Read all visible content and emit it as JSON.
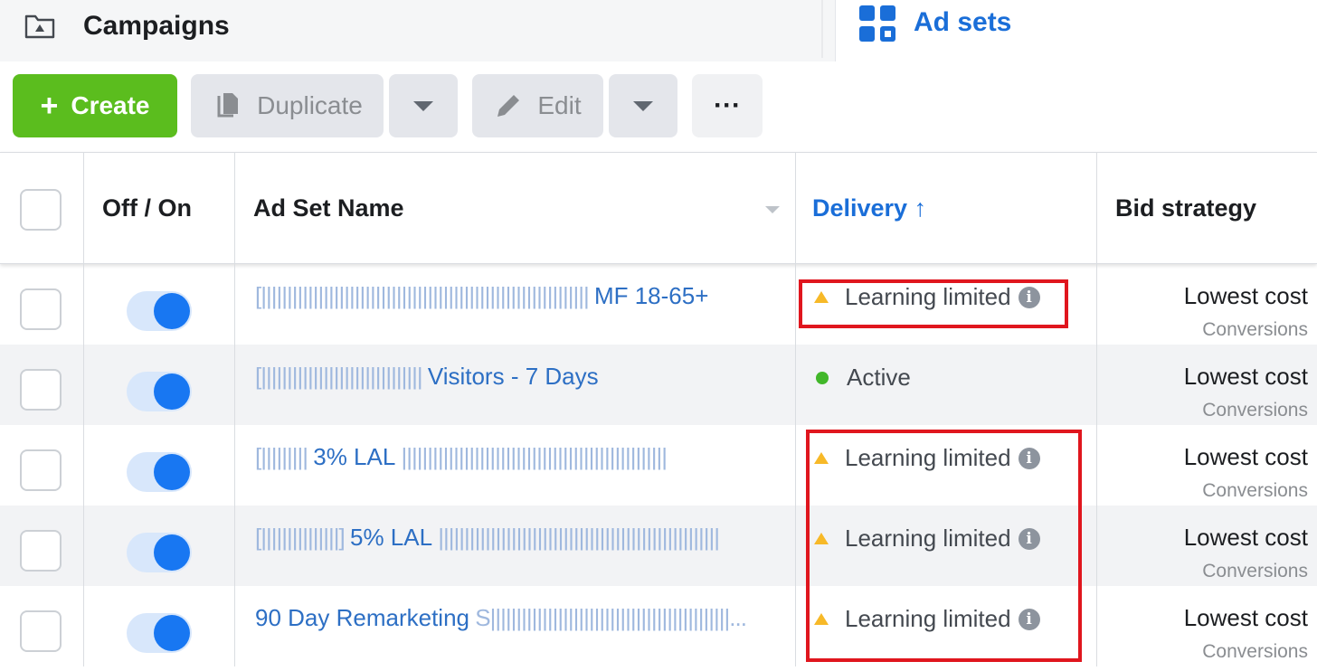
{
  "tabs": {
    "campaigns": "Campaigns",
    "ad_sets": "Ad sets"
  },
  "toolbar": {
    "create_label": "Create",
    "duplicate_label": "Duplicate",
    "edit_label": "Edit",
    "more_label": "···"
  },
  "table": {
    "columns": {
      "off_on": "Off / On",
      "name": "Ad Set Name",
      "delivery": "Delivery ↑",
      "bid_strategy": "Bid strategy"
    },
    "rows": [
      {
        "name_prefix": "[||||||||||||||||||||||||||||||||||||||||||||||||||||||||||||||| ",
        "name": "MF 18-65+",
        "toggle_on": true,
        "delivery": "Learning limited",
        "delivery_status": "warning",
        "bid_main": "Lowest cost",
        "bid_sub": "Conversions"
      },
      {
        "name_prefix": "[||||||||||||||||||||||||||||||| ",
        "name": "Visitors - 7 Days",
        "toggle_on": true,
        "delivery": "Active",
        "delivery_status": "active",
        "bid_main": "Lowest cost",
        "bid_sub": "Conversions"
      },
      {
        "name_prefix": "[||||||||| ",
        "name": "3% LAL",
        "name_suffix": " |||||||||||||||||||||||||||||||||||||||||||||||||||",
        "toggle_on": true,
        "delivery": "Learning limited",
        "delivery_status": "warning",
        "bid_main": "Lowest cost",
        "bid_sub": "Conversions"
      },
      {
        "name_prefix": "[|||||||||||||||] ",
        "name": "5% LAL",
        "name_suffix": " ||||||||||||||||||||||||||||||||||||||||||||||||||||||",
        "toggle_on": true,
        "delivery": "Learning limited",
        "delivery_status": "warning",
        "bid_main": "Lowest cost",
        "bid_sub": "Conversions"
      },
      {
        "name_prefix": "",
        "name": "90 Day Remarketing",
        "name_suffix": " S||||||||||||||||||||||||||||||||||||||||||||||...",
        "toggle_on": true,
        "delivery": "Learning limited",
        "delivery_status": "warning",
        "bid_main": "Lowest cost",
        "bid_sub": "Conversions"
      }
    ]
  },
  "colors": {
    "accent": "#1a6ed8",
    "create_green": "#5bbd1e",
    "toggle_blue": "#1877f2",
    "warning_yellow": "#f7b928",
    "active_green": "#42b72a",
    "highlight_red": "#e0161e"
  }
}
